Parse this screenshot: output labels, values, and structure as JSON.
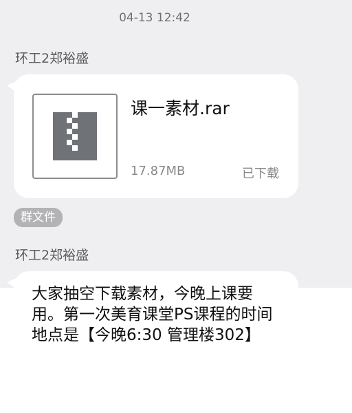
{
  "chat": {
    "timestamp": "04-13 12:42",
    "messages": [
      {
        "sender": "环工2郑裕盛",
        "file": {
          "name": "课一素材.rar",
          "size": "17.87MB",
          "status": "已下载",
          "icon": "archive-file-icon"
        },
        "tag": "群文件"
      },
      {
        "sender": "环工2郑裕盛",
        "text": "大家抽空下载素材，今晚上课要用。第一次美育课堂PS课程的时间地点是【今晚6:30 管理楼302】"
      }
    ]
  }
}
